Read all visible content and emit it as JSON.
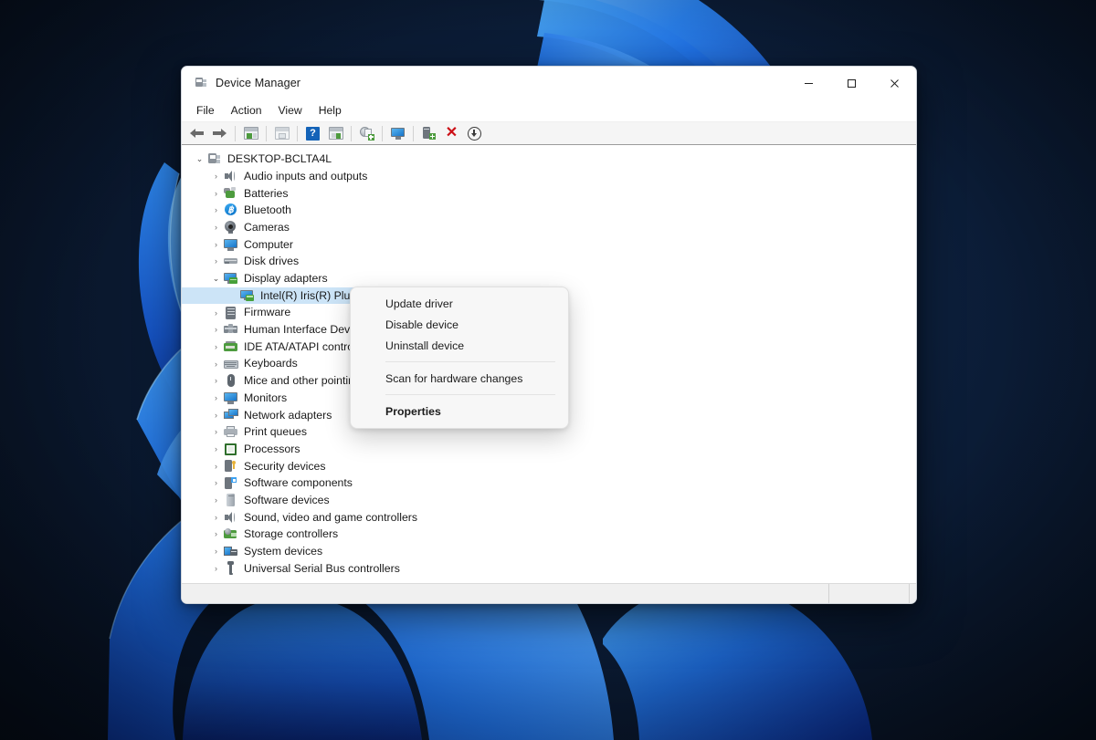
{
  "window": {
    "title": "Device Manager",
    "title_icon": "device-manager-icon",
    "controls": {
      "minimize": "─",
      "maximize": "☐",
      "close": "✕"
    }
  },
  "menubar": {
    "items": [
      {
        "label": "File"
      },
      {
        "label": "Action"
      },
      {
        "label": "View"
      },
      {
        "label": "Help"
      }
    ]
  },
  "toolbar": {
    "buttons": [
      {
        "name": "back-button",
        "icon": "arrow-left-icon",
        "tooltip": "Back"
      },
      {
        "name": "forward-button",
        "icon": "arrow-right-icon",
        "tooltip": "Forward"
      },
      {
        "name": "show-hide-console-tree-button",
        "icon": "console-tree-icon",
        "tooltip": "Show/Hide Console Tree"
      },
      {
        "name": "properties-button",
        "icon": "properties-window-icon",
        "tooltip": "Properties"
      },
      {
        "name": "help-button",
        "icon": "question-mark-icon",
        "tooltip": "Help"
      },
      {
        "name": "scan-hardware-changes-button",
        "icon": "scan-window-icon",
        "tooltip": "Scan for hardware changes"
      },
      {
        "name": "update-driver-button",
        "icon": "update-driver-icon",
        "tooltip": "Update driver"
      },
      {
        "name": "display-button",
        "icon": "monitor-icon",
        "tooltip": "Display"
      },
      {
        "name": "install-legacy-hardware-button",
        "icon": "install-device-icon",
        "tooltip": "Add legacy hardware"
      },
      {
        "name": "uninstall-device-button",
        "icon": "red-x-icon",
        "tooltip": "Uninstall device"
      },
      {
        "name": "disable-device-button",
        "icon": "disable-arrow-down-icon",
        "tooltip": "Disable device"
      }
    ]
  },
  "tree": {
    "root": {
      "label": "DESKTOP-BCLTA4L",
      "icon": "computer-node-icon",
      "expanded": true,
      "indent": 0
    },
    "items": [
      {
        "label": "Audio inputs and outputs",
        "icon": "speaker-icon",
        "indent": 1,
        "expanded": false
      },
      {
        "label": "Batteries",
        "icon": "battery-icon",
        "indent": 1,
        "expanded": false
      },
      {
        "label": "Bluetooth",
        "icon": "bluetooth-icon",
        "indent": 1,
        "expanded": false
      },
      {
        "label": "Cameras",
        "icon": "camera-icon",
        "indent": 1,
        "expanded": false
      },
      {
        "label": "Computer",
        "icon": "monitor-icon",
        "indent": 1,
        "expanded": false
      },
      {
        "label": "Disk drives",
        "icon": "disk-drive-icon",
        "indent": 1,
        "expanded": false
      },
      {
        "label": "Display adapters",
        "icon": "display-adapter-icon",
        "indent": 1,
        "expanded": true
      },
      {
        "label": "Intel(R) Iris(R) Plus Graphics",
        "icon": "display-adapter-icon",
        "indent": 2,
        "expanded": null,
        "selected": true
      },
      {
        "label": "Firmware",
        "icon": "firmware-icon",
        "indent": 1,
        "expanded": false
      },
      {
        "label": "Human Interface Devices",
        "icon": "hid-icon",
        "indent": 1,
        "expanded": false
      },
      {
        "label": "IDE ATA/ATAPI controllers",
        "icon": "ide-controller-icon",
        "indent": 1,
        "expanded": false
      },
      {
        "label": "Keyboards",
        "icon": "keyboard-icon",
        "indent": 1,
        "expanded": false
      },
      {
        "label": "Mice and other pointing devices",
        "icon": "mouse-icon",
        "indent": 1,
        "expanded": false
      },
      {
        "label": "Monitors",
        "icon": "monitor-icon",
        "indent": 1,
        "expanded": false
      },
      {
        "label": "Network adapters",
        "icon": "network-adapter-icon",
        "indent": 1,
        "expanded": false
      },
      {
        "label": "Print queues",
        "icon": "printer-icon",
        "indent": 1,
        "expanded": false
      },
      {
        "label": "Processors",
        "icon": "processor-icon",
        "indent": 1,
        "expanded": false
      },
      {
        "label": "Security devices",
        "icon": "security-key-icon",
        "indent": 1,
        "expanded": false
      },
      {
        "label": "Software components",
        "icon": "software-component-icon",
        "indent": 1,
        "expanded": false
      },
      {
        "label": "Software devices",
        "icon": "software-device-icon",
        "indent": 1,
        "expanded": false
      },
      {
        "label": "Sound, video and game controllers",
        "icon": "speaker-icon",
        "indent": 1,
        "expanded": false
      },
      {
        "label": "Storage controllers",
        "icon": "storage-controller-icon",
        "indent": 1,
        "expanded": false
      },
      {
        "label": "System devices",
        "icon": "system-device-icon",
        "indent": 1,
        "expanded": false
      },
      {
        "label": "Universal Serial Bus controllers",
        "icon": "usb-icon",
        "indent": 1,
        "expanded": false
      }
    ],
    "chevron_collapsed": "›",
    "chevron_expanded": "⌄"
  },
  "context_menu": {
    "items": [
      {
        "label": "Update driver",
        "bold": false,
        "separator_after": false
      },
      {
        "label": "Disable device",
        "bold": false,
        "separator_after": false
      },
      {
        "label": "Uninstall device",
        "bold": false,
        "separator_after": true
      },
      {
        "label": "Scan for hardware changes",
        "bold": false,
        "separator_after": true
      },
      {
        "label": "Properties",
        "bold": true,
        "separator_after": false
      }
    ]
  },
  "statusbar": {
    "panel1": "",
    "panel2": "",
    "panel3": ""
  },
  "colors": {
    "accent": "#0a72c8",
    "selection": "#cce4f7",
    "window_bg": "#ffffff",
    "toolbar_bg": "#f5f5f5",
    "menu_bg": "#f7f7f7",
    "desktop_bg": "#081425",
    "close_hover": "#c42b1c",
    "red_x": "#cc0f16",
    "green": "#4d9b3e"
  }
}
